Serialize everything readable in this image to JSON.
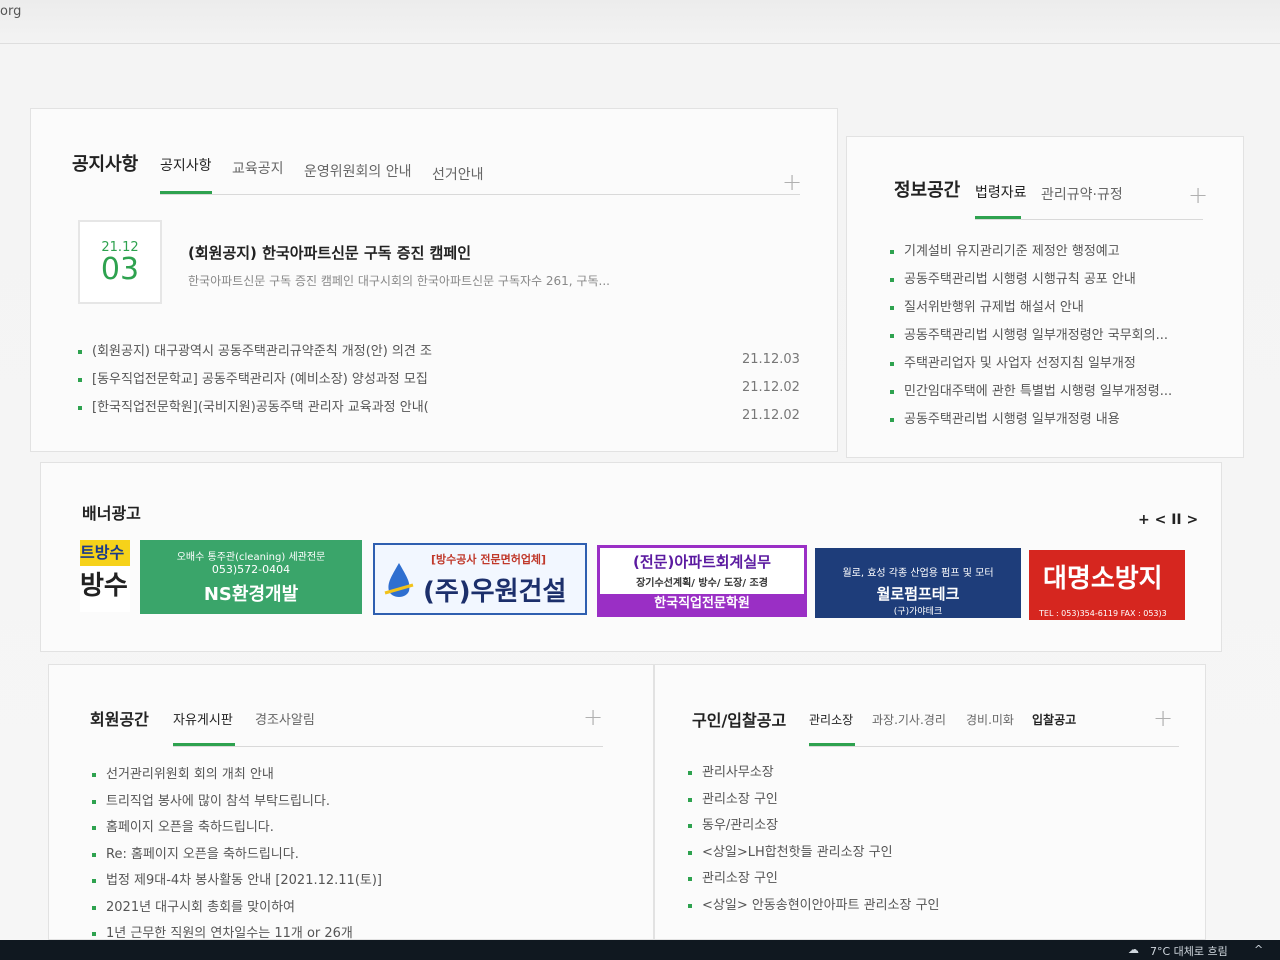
{
  "browser": {
    "url_fragment": "org"
  },
  "notice": {
    "title": "공지사항",
    "tabs": [
      {
        "label": "공지사항",
        "active": true
      },
      {
        "label": "교육공지",
        "active": false
      },
      {
        "label": "운영위원회의 안내",
        "active": false
      },
      {
        "label": "선거안내",
        "active": false
      }
    ],
    "more": "+",
    "featured": {
      "year_month": "21.12",
      "day": "03",
      "headline": "(회원공지) 한국아파트신문 구독 증진 캠페인",
      "summary": "한국아파트신문 구독 증진 캠페인 대구시회의 한국아파트신문 구독자수 261, 구독..."
    },
    "items": [
      {
        "text": "(회원공지) 대구광역시 공동주택관리규약준칙 개정(안) 의견 조",
        "date": "21.12.03"
      },
      {
        "text": "[동우직업전문학교] 공동주택관리자 (예비소장) 양성과정 모집",
        "date": "21.12.02"
      },
      {
        "text": "[한국직업전문학원](국비지원)공동주택 관리자 교육과정 안내(",
        "date": "21.12.02"
      }
    ]
  },
  "info": {
    "title": "정보공간",
    "tabs": [
      {
        "label": "법령자료",
        "active": true
      },
      {
        "label": "관리규약·규정",
        "active": false
      }
    ],
    "more": "+",
    "items": [
      "기계설비 유지관리기준 제정안 행정예고",
      "공동주택관리법 시행령 시행규칙 공포 안내",
      "질서위반행위 규제법 해설서 안내",
      "공동주택관리법 시행령 일부개정령안 국무회의...",
      "주택관리업자 및 사업자 선정지침 일부개정",
      "민간임대주택에 관한 특별법 시행령 일부개정령...",
      "공동주택관리법 시행령 일부개정령 내용"
    ]
  },
  "banners": {
    "title": "배너광고",
    "controls": "+ < II >",
    "items": [
      {
        "line1": "트방수",
        "line2": "방수"
      },
      {
        "line1": "오배수 통주관(cleaning) 세관전문",
        "line2": "053)572-0404",
        "line3": "NS환경개발"
      },
      {
        "line1": "[방수공사 전문면허업체]",
        "line2": "(주)우원건설"
      },
      {
        "line1": "(전문)아파트회계실무",
        "line2": "장기수선계획/ 방수/ 도장/ 조경",
        "line3": "한국직업전문학원"
      },
      {
        "line1": "월로, 효성 각종 산업용 펌프 및 모터",
        "line2": "월로펌프테크",
        "line3": "(구)가야테크"
      },
      {
        "line1": "대명소방지",
        "line2": "TEL : 053)354-6119    FAX : 053)3"
      }
    ]
  },
  "member": {
    "title": "회원공간",
    "tabs": [
      {
        "label": "자유게시판",
        "active": true
      },
      {
        "label": "경조사알림",
        "active": false
      }
    ],
    "more": "+",
    "items": [
      "선거관리위원회 회의 개최 안내",
      "트리직업 봉사에 많이 참석 부탁드립니다.",
      "홈페이지 오픈을 축하드립니다.",
      "Re: 홈페이지 오픈을 축하드립니다.",
      "법정 제9대-4차 봉사활동 안내 [2021.12.11(토)]",
      "2021년 대구시회 총회를 맞이하여",
      "1년 근무한 직원의 연차일수는 11개 or 26개"
    ]
  },
  "jobs": {
    "title": "구인/입찰공고",
    "tabs": [
      {
        "label": "관리소장",
        "active": true
      },
      {
        "label": "과장.기사.경리",
        "active": false
      },
      {
        "label": "경비.미화",
        "active": false
      },
      {
        "label": "입찰공고",
        "active": false
      }
    ],
    "more": "+",
    "items": [
      "관리사무소장",
      "관리소장 구인",
      "동우/관리소장",
      "<상일>LH합천핫들 관리소장 구인",
      "관리소장 구인",
      "<상일> 안동송현이안아파트 관리소장 구인"
    ]
  },
  "taskbar": {
    "weather": "7°C 대체로 흐림",
    "tray": "^"
  }
}
